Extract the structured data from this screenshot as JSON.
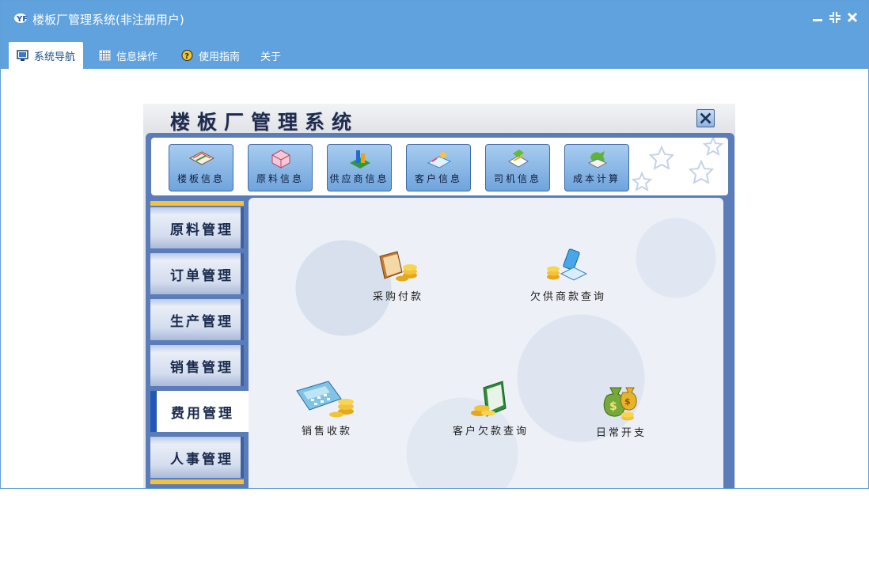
{
  "window": {
    "title": "楼板厂管理系统(非注册用户)",
    "controls": [
      "minimize-icon",
      "restore-icon",
      "close-icon"
    ]
  },
  "menu": {
    "tabs": [
      {
        "label": "系统导航",
        "icon": "monitor-icon",
        "active": true
      },
      {
        "label": "信息操作",
        "icon": "grid-icon",
        "active": false
      },
      {
        "label": "使用指南",
        "icon": "help-icon",
        "active": false
      },
      {
        "label": "关于",
        "icon": "",
        "active": false
      }
    ]
  },
  "panel": {
    "title": "楼板厂管理系统",
    "toolbar": [
      {
        "label": "楼板信息",
        "icon": "book-icon"
      },
      {
        "label": "原料信息",
        "icon": "box-icon"
      },
      {
        "label": "供应商信息",
        "icon": "chart-icon"
      },
      {
        "label": "客户信息",
        "icon": "customer-icon"
      },
      {
        "label": "司机信息",
        "icon": "driver-icon"
      },
      {
        "label": "成本计算",
        "icon": "cost-icon"
      }
    ],
    "nav": [
      {
        "label": "原料管理",
        "active": false
      },
      {
        "label": "订单管理",
        "active": false
      },
      {
        "label": "生产管理",
        "active": false
      },
      {
        "label": "销售管理",
        "active": false
      },
      {
        "label": "费用管理",
        "active": true
      },
      {
        "label": "人事管理",
        "active": false
      }
    ],
    "functions": [
      {
        "label": "采购付款",
        "icon": "ledger-coins-icon"
      },
      {
        "label": "欠供商款查询",
        "icon": "supplier-debt-icon"
      },
      {
        "label": "销售收款",
        "icon": "calculator-coins-icon"
      },
      {
        "label": "客户欠款查询",
        "icon": "customer-debt-icon"
      },
      {
        "label": "日常开支",
        "icon": "money-bag-icon"
      }
    ]
  },
  "colors": {
    "titlebar": "#5fa2dd",
    "panel_frame": "#5a7cb8",
    "accent": "#2357b8"
  }
}
